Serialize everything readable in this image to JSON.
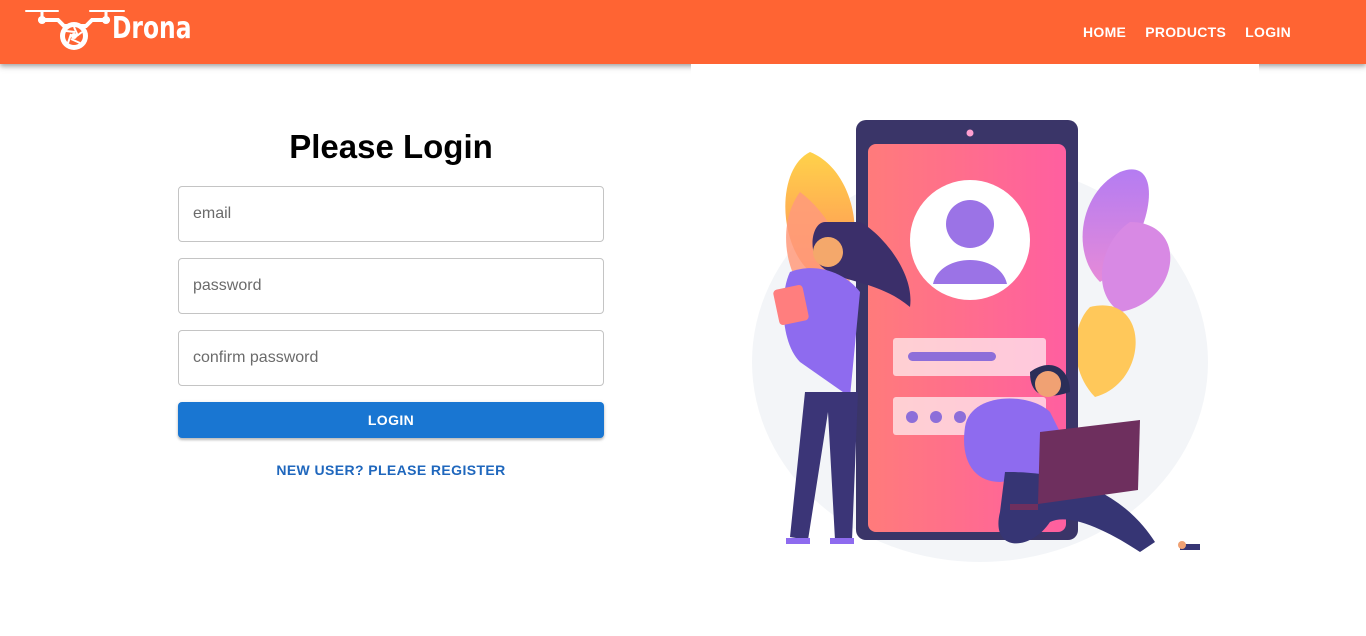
{
  "header": {
    "brand_name": "Drona",
    "logo_icon": "drone-icon",
    "nav": [
      {
        "label": "HOME"
      },
      {
        "label": "PRODUCTS"
      },
      {
        "label": "LOGIN"
      }
    ],
    "color": "#ff6433"
  },
  "login_form": {
    "title": "Please Login",
    "email_placeholder": "email",
    "email_value": "",
    "password_placeholder": "password",
    "password_value": "",
    "confirm_placeholder": "confirm password",
    "confirm_value": "",
    "submit_label": "LOGIN",
    "register_link": "NEW USER? PLEASE REGISTER",
    "button_color": "#1976d2"
  },
  "illustration": {
    "icon": "mobile-login-illustration"
  }
}
